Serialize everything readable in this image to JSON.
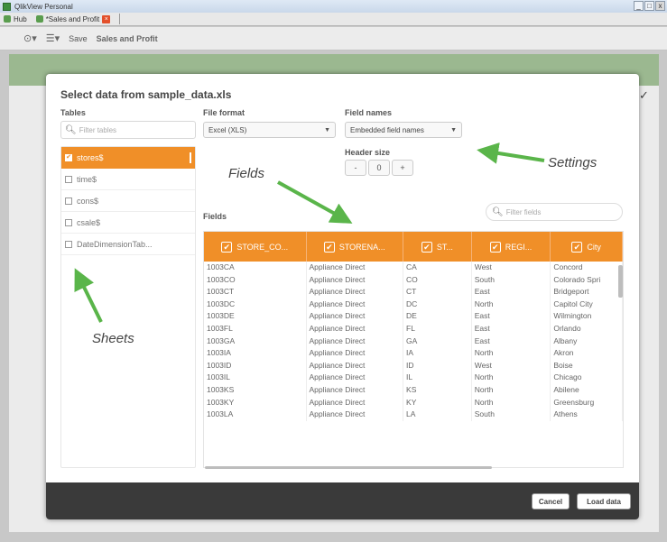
{
  "window": {
    "title": "QlikView Personal",
    "controls": [
      "_",
      "□",
      "x"
    ]
  },
  "tabs": [
    {
      "label": "Hub"
    },
    {
      "label": "*Sales and Profit"
    }
  ],
  "toolbar": {
    "save_label": "Save",
    "app_title": "Sales and Profit"
  },
  "dialog": {
    "title": "Select data from sample_data.xls",
    "tables_label": "Tables",
    "tables_filter_placeholder": "Filter tables",
    "tables": [
      {
        "name": "stores$",
        "selected": true
      },
      {
        "name": "time$",
        "selected": false
      },
      {
        "name": "cons$",
        "selected": false
      },
      {
        "name": "csale$",
        "selected": false
      },
      {
        "name": "DateDimensionTab...",
        "selected": false
      }
    ],
    "file_format_label": "File format",
    "file_format_value": "Excel (XLS)",
    "field_names_label": "Field names",
    "field_names_value": "Embedded field names",
    "header_size_label": "Header size",
    "header_size_value": "0",
    "fields_label": "Fields",
    "fields_filter_placeholder": "Filter fields",
    "columns": [
      "STORE_CO...",
      "STORENA...",
      "ST...",
      "REGI...",
      "City"
    ],
    "rows": [
      [
        "1003CA",
        "Appliance Direct",
        "CA",
        "West",
        "Concord"
      ],
      [
        "1003CO",
        "Appliance Direct",
        "CO",
        "South",
        "Colorado Spri"
      ],
      [
        "1003CT",
        "Appliance Direct",
        "CT",
        "East",
        "Bridgeport"
      ],
      [
        "1003DC",
        "Appliance Direct",
        "DC",
        "North",
        "Capitol City"
      ],
      [
        "1003DE",
        "Appliance Direct",
        "DE",
        "East",
        "Wilmington"
      ],
      [
        "1003FL",
        "Appliance Direct",
        "FL",
        "East",
        "Orlando"
      ],
      [
        "1003GA",
        "Appliance Direct",
        "GA",
        "East",
        "Albany"
      ],
      [
        "1003IA",
        "Appliance Direct",
        "IA",
        "North",
        "Akron"
      ],
      [
        "1003ID",
        "Appliance Direct",
        "ID",
        "West",
        "Boise"
      ],
      [
        "1003IL",
        "Appliance Direct",
        "IL",
        "North",
        "Chicago"
      ],
      [
        "1003KS",
        "Appliance Direct",
        "KS",
        "North",
        "Abilene"
      ],
      [
        "1003KY",
        "Appliance Direct",
        "KY",
        "North",
        "Greensburg"
      ],
      [
        "1003LA",
        "Appliance Direct",
        "LA",
        "South",
        "Athens"
      ]
    ],
    "cancel_label": "Cancel",
    "load_label": "Load data"
  },
  "annotations": {
    "fields": "Fields",
    "settings": "Settings",
    "sheets": "Sheets"
  },
  "colors": {
    "accent": "#f08f28",
    "annotation_arrow": "#5ab54a",
    "footer": "#3a3a3a"
  }
}
